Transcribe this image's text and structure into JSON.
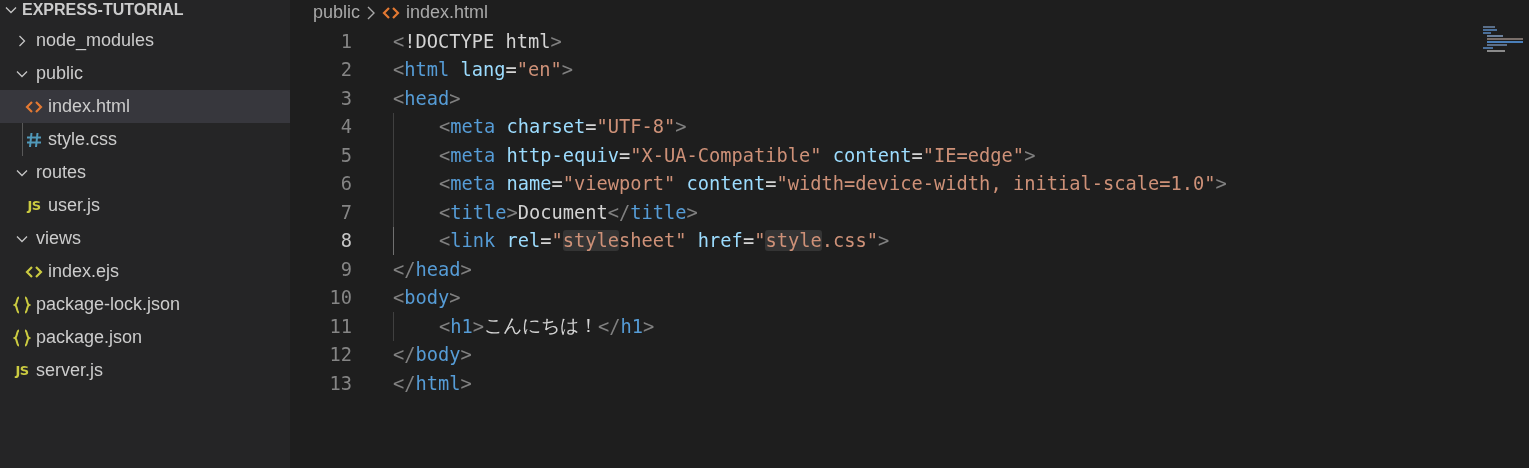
{
  "explorer": {
    "title": "EXPRESS-TUTORIAL",
    "expanded": true,
    "items": [
      {
        "label": "node_modules",
        "kind": "folder",
        "expanded": false,
        "selected": false
      },
      {
        "label": "public",
        "kind": "folder",
        "expanded": true,
        "selected": false,
        "children": [
          {
            "label": "index.html",
            "kind": "html",
            "selected": true
          },
          {
            "label": "style.css",
            "kind": "css",
            "selected": false
          }
        ]
      },
      {
        "label": "routes",
        "kind": "folder",
        "expanded": true,
        "selected": false,
        "children": [
          {
            "label": "user.js",
            "kind": "js",
            "glyph": "JS",
            "selected": false
          }
        ]
      },
      {
        "label": "views",
        "kind": "folder",
        "expanded": true,
        "selected": false,
        "children": [
          {
            "label": "index.ejs",
            "kind": "ejs",
            "selected": false
          }
        ]
      },
      {
        "label": "package-lock.json",
        "kind": "json",
        "selected": false
      },
      {
        "label": "package.json",
        "kind": "json",
        "selected": false
      },
      {
        "label": "server.js",
        "kind": "js",
        "glyph": "JS",
        "selected": false
      }
    ]
  },
  "breadcrumb": {
    "folder": "public",
    "file": "index.html"
  },
  "code": [
    {
      "number": "1",
      "indented": false,
      "active": false,
      "tokens": [
        {
          "t": "<",
          "kind": "punct"
        },
        {
          "t": "!DOCTYPE html",
          "kind": "text"
        },
        {
          "t": ">",
          "kind": "punct"
        }
      ]
    },
    {
      "number": "2",
      "indented": false,
      "active": false,
      "tokens": [
        {
          "t": "<",
          "kind": "punct"
        },
        {
          "t": "html",
          "kind": "tag"
        },
        {
          "t": " lang",
          "kind": "attr"
        },
        {
          "t": "=",
          "kind": "text"
        },
        {
          "t": "\"en\"",
          "kind": "str"
        },
        {
          "t": ">",
          "kind": "punct"
        }
      ]
    },
    {
      "number": "3",
      "indented": false,
      "active": false,
      "tokens": [
        {
          "t": "<",
          "kind": "punct"
        },
        {
          "t": "head",
          "kind": "tag"
        },
        {
          "t": ">",
          "kind": "punct"
        }
      ]
    },
    {
      "number": "4",
      "indented": true,
      "active": false,
      "tokens": [
        {
          "t": "<",
          "kind": "punct"
        },
        {
          "t": "meta",
          "kind": "tag"
        },
        {
          "t": " charset",
          "kind": "attr"
        },
        {
          "t": "=",
          "kind": "text"
        },
        {
          "t": "\"UTF-8\"",
          "kind": "str"
        },
        {
          "t": ">",
          "kind": "punct"
        }
      ]
    },
    {
      "number": "5",
      "indented": true,
      "active": false,
      "tokens": [
        {
          "t": "<",
          "kind": "punct"
        },
        {
          "t": "meta",
          "kind": "tag"
        },
        {
          "t": " http-equiv",
          "kind": "attr"
        },
        {
          "t": "=",
          "kind": "text"
        },
        {
          "t": "\"X-UA-Compatible\"",
          "kind": "str"
        },
        {
          "t": " content",
          "kind": "attr"
        },
        {
          "t": "=",
          "kind": "text"
        },
        {
          "t": "\"IE=edge\"",
          "kind": "str"
        },
        {
          "t": ">",
          "kind": "punct"
        }
      ]
    },
    {
      "number": "6",
      "indented": true,
      "active": false,
      "tokens": [
        {
          "t": "<",
          "kind": "punct"
        },
        {
          "t": "meta",
          "kind": "tag"
        },
        {
          "t": " name",
          "kind": "attr"
        },
        {
          "t": "=",
          "kind": "text"
        },
        {
          "t": "\"viewport\"",
          "kind": "str"
        },
        {
          "t": " content",
          "kind": "attr"
        },
        {
          "t": "=",
          "kind": "text"
        },
        {
          "t": "\"width=device-width, initial-scale=1.0\"",
          "kind": "str"
        },
        {
          "t": ">",
          "kind": "punct"
        }
      ]
    },
    {
      "number": "7",
      "indented": true,
      "active": false,
      "tokens": [
        {
          "t": "<",
          "kind": "punct"
        },
        {
          "t": "title",
          "kind": "tag"
        },
        {
          "t": ">",
          "kind": "punct"
        },
        {
          "t": "Document",
          "kind": "text"
        },
        {
          "t": "</",
          "kind": "punct"
        },
        {
          "t": "title",
          "kind": "tag"
        },
        {
          "t": ">",
          "kind": "punct"
        }
      ]
    },
    {
      "number": "8",
      "indented": true,
      "active": true,
      "tokens": [
        {
          "t": "<",
          "kind": "punct"
        },
        {
          "t": "link",
          "kind": "tag"
        },
        {
          "t": " rel",
          "kind": "attr"
        },
        {
          "t": "=",
          "kind": "text"
        },
        {
          "t": "\"",
          "kind": "str"
        },
        {
          "t": "style",
          "kind": "str",
          "highlight": true
        },
        {
          "t": "sheet\"",
          "kind": "str"
        },
        {
          "t": " href",
          "kind": "attr"
        },
        {
          "t": "=",
          "kind": "text"
        },
        {
          "t": "\"",
          "kind": "str"
        },
        {
          "t": "style",
          "kind": "str",
          "highlight": true
        },
        {
          "t": ".css\"",
          "kind": "str"
        },
        {
          "t": ">",
          "kind": "punct"
        }
      ]
    },
    {
      "number": "9",
      "indented": false,
      "active": false,
      "tokens": [
        {
          "t": "</",
          "kind": "punct"
        },
        {
          "t": "head",
          "kind": "tag"
        },
        {
          "t": ">",
          "kind": "punct"
        }
      ]
    },
    {
      "number": "10",
      "indented": false,
      "active": false,
      "tokens": [
        {
          "t": "<",
          "kind": "punct"
        },
        {
          "t": "body",
          "kind": "tag"
        },
        {
          "t": ">",
          "kind": "punct"
        }
      ]
    },
    {
      "number": "11",
      "indented": true,
      "active": false,
      "tokens": [
        {
          "t": "<",
          "kind": "punct"
        },
        {
          "t": "h1",
          "kind": "tag"
        },
        {
          "t": ">",
          "kind": "punct"
        },
        {
          "t": "こんにちは！",
          "kind": "text"
        },
        {
          "t": "</",
          "kind": "punct"
        },
        {
          "t": "h1",
          "kind": "tag"
        },
        {
          "t": ">",
          "kind": "punct"
        }
      ]
    },
    {
      "number": "12",
      "indented": false,
      "active": false,
      "tokens": [
        {
          "t": "</",
          "kind": "punct"
        },
        {
          "t": "body",
          "kind": "tag"
        },
        {
          "t": ">",
          "kind": "punct"
        }
      ]
    },
    {
      "number": "13",
      "indented": false,
      "active": false,
      "tokens": [
        {
          "t": "</",
          "kind": "punct"
        },
        {
          "t": "html",
          "kind": "tag"
        },
        {
          "t": ">",
          "kind": "punct"
        }
      ]
    }
  ]
}
